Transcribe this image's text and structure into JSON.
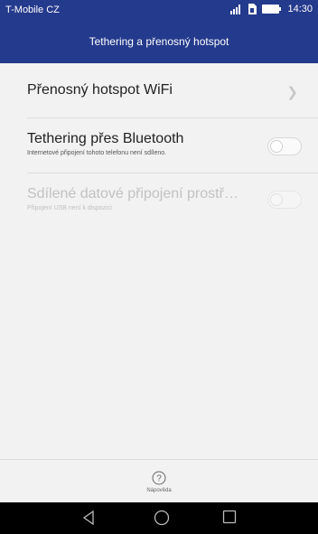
{
  "status_bar": {
    "carrier": "T-Mobile CZ",
    "time": "14:30",
    "icons": [
      "signal-icon",
      "sim-icon",
      "battery-icon"
    ]
  },
  "header": {
    "title": "Tethering a přenosný hotspot"
  },
  "settings": {
    "wifi_hotspot": {
      "label": "Přenosný hotspot WiFi"
    },
    "bluetooth": {
      "label": "Tethering přes Bluetooth",
      "sublabel": "Internetové připojení tohoto telefonu není sdíleno.",
      "enabled": false
    },
    "usb": {
      "label": "Sdílené datové připojení prostř…",
      "sublabel": "Připojení USB není k dispozici",
      "enabled": false,
      "available": false
    }
  },
  "bottom_bar": {
    "help_label": "Nápověda"
  },
  "colors": {
    "accent": "#243a8c",
    "marker": "#e2006e",
    "background": "#f2f2f2"
  }
}
